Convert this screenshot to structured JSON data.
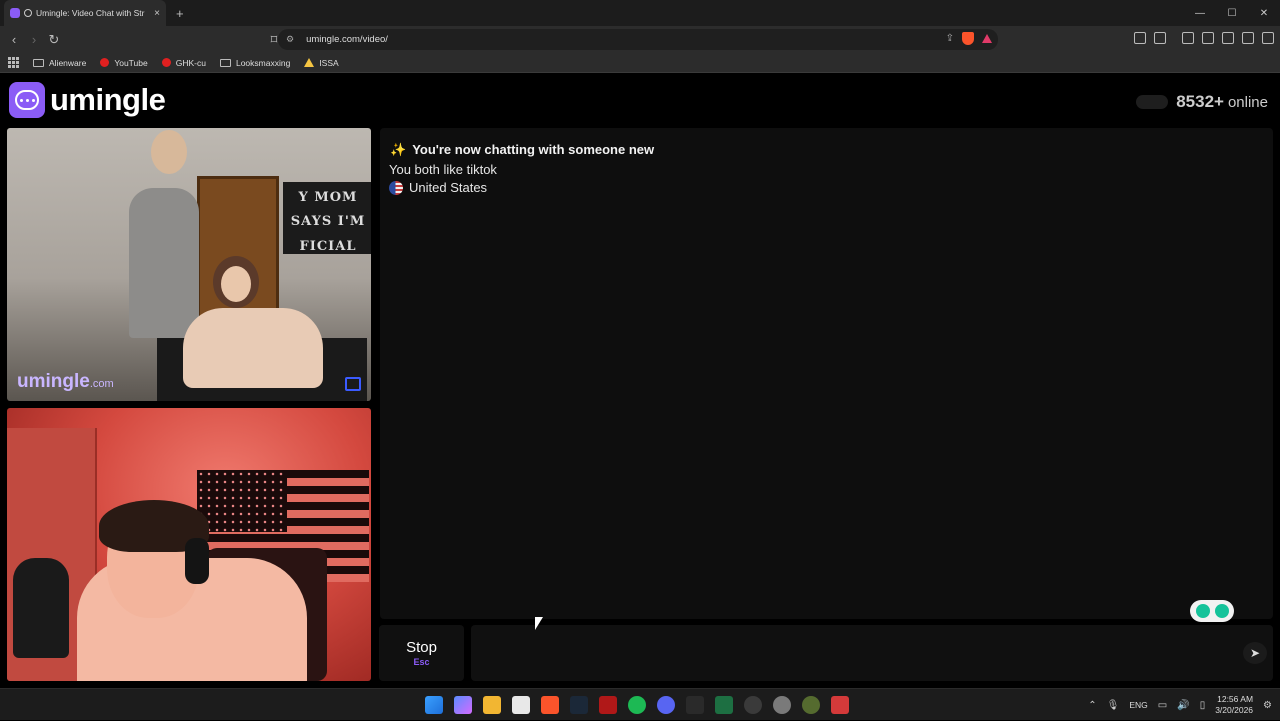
{
  "browser": {
    "tab_title": "Umingle: Video Chat with Str",
    "tab_close": "×",
    "new_tab": "+",
    "url": "umingle.com/video/",
    "window_controls": [
      "—",
      "☐",
      "✕"
    ],
    "bookmarks": [
      {
        "label": "Alienware",
        "icon": "folder-icon"
      },
      {
        "label": "YouTube",
        "icon": "youtube-icon"
      },
      {
        "label": "GHK-cu",
        "icon": "ghk-icon"
      },
      {
        "label": "Looksmaxxing",
        "icon": "folder-icon"
      },
      {
        "label": "ISSA",
        "icon": "issa-icon"
      }
    ]
  },
  "header": {
    "logo_text": "umingle",
    "online_count": "8532+",
    "online_label": "online"
  },
  "video": {
    "stranger_brand": "umingle",
    "stranger_brand_suffix": ".com",
    "stranger_banner_text": [
      "Y MOM",
      "SAYS I'M",
      "FICIAL"
    ]
  },
  "chat": {
    "status_line": "You're now chatting with someone new",
    "status_icon": "✨",
    "shared_interest": "You both like tiktok",
    "country": "United States"
  },
  "controls": {
    "stop_label": "Stop",
    "stop_key": "Esc",
    "message_placeholder": "",
    "send_icon": "➤"
  },
  "taskbar": {
    "language": "ENG",
    "time": "12:56 AM",
    "date": "3/20/2026",
    "icons": [
      "windows-start-icon",
      "copilot-icon",
      "file-explorer-icon",
      "store-icon",
      "brave-icon",
      "steam-icon",
      "app-icon",
      "spotify-icon",
      "discord-icon",
      "epic-games-icon",
      "excel-icon",
      "app-icon",
      "settings-icon",
      "app-icon",
      "app-icon"
    ]
  },
  "colors": {
    "accent": "#8b5cf6",
    "background": "#000000",
    "panel": "#0e0e0e"
  }
}
